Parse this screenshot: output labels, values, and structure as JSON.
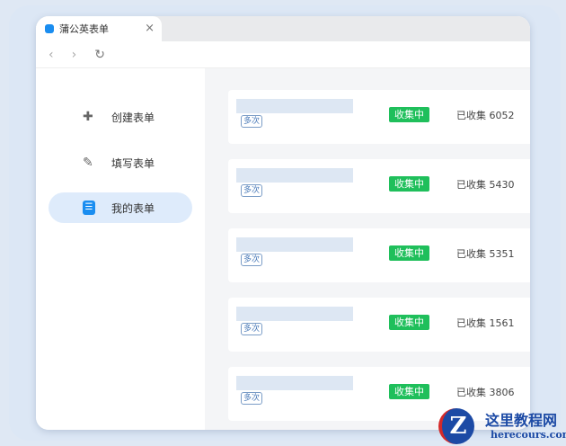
{
  "browser": {
    "tab_title": "蒲公英表单",
    "close": "×",
    "back": "‹",
    "forward": "›",
    "reload": "↻"
  },
  "sidebar": {
    "items": [
      {
        "label": "创建表单",
        "icon": "add-form-icon",
        "glyph": "✚"
      },
      {
        "label": "填写表单",
        "icon": "edit-form-icon",
        "glyph": "✎"
      },
      {
        "label": "我的表单",
        "icon": "document-icon",
        "glyph": "☰",
        "active": true
      }
    ]
  },
  "forms": [
    {
      "tag": "多次",
      "status": "收集中",
      "count": "已收集 6052"
    },
    {
      "tag": "多次",
      "status": "收集中",
      "count": "已收集 5430"
    },
    {
      "tag": "多次",
      "status": "收集中",
      "count": "已收集 5351"
    },
    {
      "tag": "多次",
      "status": "收集中",
      "count": "已收集 1561"
    },
    {
      "tag": "多次",
      "status": "收集中",
      "count": "已收集 3806"
    }
  ],
  "watermark": {
    "logo": "Z",
    "title": "这里教程网",
    "url": "herecours.com"
  },
  "colors": {
    "accent": "#1a8df0",
    "status_green": "#1fbf5b"
  }
}
